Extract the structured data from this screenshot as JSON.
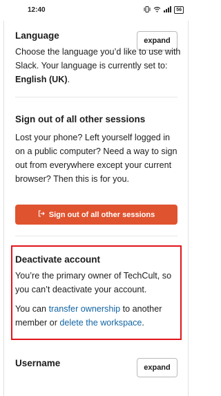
{
  "status_bar": {
    "time": "12:40",
    "icons": [
      "vibrate-icon",
      "wifi-icon",
      "signal-icon"
    ],
    "battery": "56"
  },
  "language": {
    "title": "Language",
    "desc_prefix": "Choose the language you’d like to use with Slack. Your language is currently set to: ",
    "current": "English (UK)",
    "desc_suffix": ".",
    "expand_label": "expand"
  },
  "sign_out": {
    "title": "Sign out of all other sessions",
    "desc": "Lost your phone? Left yourself logged in on a public computer? Need a way to sign out from everywhere except your current browser? Then this is for you.",
    "button_label": "Sign out of all other sessions"
  },
  "deactivate": {
    "title": "Deactivate account",
    "desc": "You’re the primary owner of TechCult, so you can’t deactivate your account.",
    "line2_prefix": "You can ",
    "transfer_link": "transfer ownership",
    "line2_mid": " to another member or ",
    "delete_link": "delete the workspace",
    "line2_suffix": "."
  },
  "username": {
    "title": "Username",
    "expand_label": "expand"
  },
  "colors": {
    "danger": "#e0532f",
    "link": "#1264a3",
    "highlight": "#e3141c"
  }
}
